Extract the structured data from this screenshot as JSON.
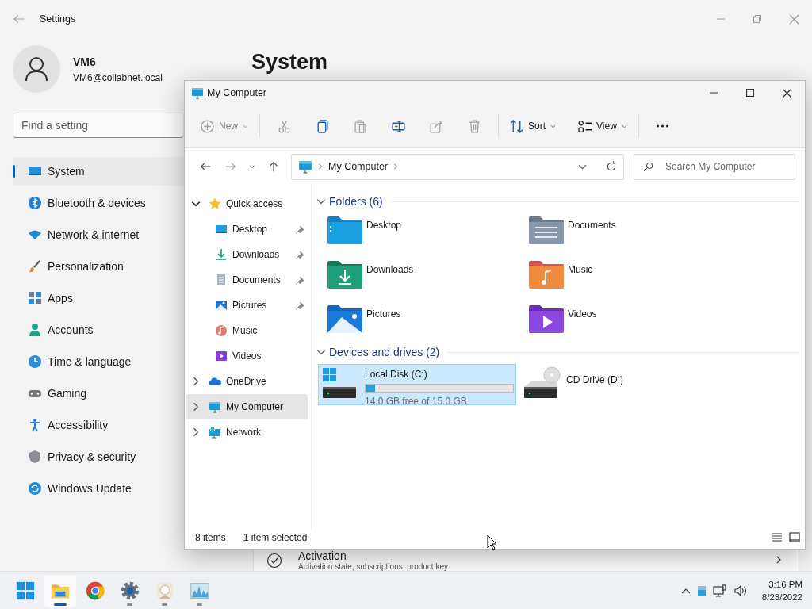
{
  "settings": {
    "title": "Settings",
    "user": {
      "name": "VM6",
      "email": "VM6@collabnet.local"
    },
    "search": {
      "placeholder": "Find a setting"
    },
    "nav": [
      {
        "label": "System",
        "selected": true
      },
      {
        "label": "Bluetooth & devices",
        "selected": false
      },
      {
        "label": "Network & internet",
        "selected": false
      },
      {
        "label": "Personalization",
        "selected": false
      },
      {
        "label": "Apps",
        "selected": false
      },
      {
        "label": "Accounts",
        "selected": false
      },
      {
        "label": "Time & language",
        "selected": false
      },
      {
        "label": "Gaming",
        "selected": false
      },
      {
        "label": "Accessibility",
        "selected": false
      },
      {
        "label": "Privacy & security",
        "selected": false
      },
      {
        "label": "Windows Update",
        "selected": false
      }
    ],
    "page_title": "System",
    "activation": {
      "title": "Activation",
      "subtitle": "Activation state, subscriptions, product key"
    }
  },
  "explorer": {
    "title": "My Computer",
    "toolbar": [
      {
        "kind": "new",
        "label": "New",
        "disabled": true
      },
      {
        "kind": "cut",
        "disabled": true
      },
      {
        "kind": "copy",
        "disabled": false
      },
      {
        "kind": "paste",
        "disabled": true
      },
      {
        "kind": "rename",
        "disabled": false
      },
      {
        "kind": "share",
        "disabled": true
      },
      {
        "kind": "delete",
        "disabled": true
      },
      {
        "kind": "sort",
        "label": "Sort",
        "disabled": false
      },
      {
        "kind": "view",
        "label": "View",
        "disabled": false
      },
      {
        "kind": "more",
        "disabled": false
      }
    ],
    "address": {
      "crumbs": [
        "My Computer"
      ]
    },
    "search": {
      "placeholder": "Search My Computer"
    },
    "tree": [
      {
        "label": "Quick access",
        "expanded": true,
        "selected": false,
        "children": [
          {
            "label": "Desktop",
            "pinned": true,
            "selected": false
          },
          {
            "label": "Downloads",
            "pinned": true,
            "selected": false
          },
          {
            "label": "Documents",
            "pinned": true,
            "selected": false
          },
          {
            "label": "Pictures",
            "pinned": true,
            "selected": false
          },
          {
            "label": "Music",
            "pinned": false,
            "selected": false
          },
          {
            "label": "Videos",
            "pinned": false,
            "selected": false
          }
        ]
      },
      {
        "label": "OneDrive",
        "expanded": false,
        "selected": false
      },
      {
        "label": "My Computer",
        "expanded": false,
        "selected": true
      },
      {
        "label": "Network",
        "expanded": false,
        "selected": false
      }
    ],
    "groups": [
      {
        "kind": "folders",
        "title": "Folders (6)",
        "expanded": true,
        "items": [
          {
            "label": "Desktop",
            "selected": false
          },
          {
            "label": "Documents",
            "selected": false
          },
          {
            "label": "Downloads",
            "selected": false
          },
          {
            "label": "Music",
            "selected": false
          },
          {
            "label": "Pictures",
            "selected": false
          },
          {
            "label": "Videos",
            "selected": false
          }
        ]
      },
      {
        "kind": "drives",
        "title": "Devices and drives (2)",
        "expanded": true,
        "items": [
          {
            "label": "Local Disk (C:)",
            "selected": true,
            "level": 0.067,
            "detail": "14.0 GB free of 15.0 GB"
          },
          {
            "label": "CD Drive (D:)",
            "selected": false
          }
        ]
      }
    ],
    "status": {
      "count": "8 items",
      "selection": "1 item selected"
    }
  },
  "taskbar": {
    "apps": [
      {
        "running": false,
        "active": false
      },
      {
        "running": true,
        "active": true
      },
      {
        "running": false,
        "active": false
      },
      {
        "running": true,
        "active": false
      },
      {
        "running": true,
        "active": false
      },
      {
        "running": true,
        "active": false
      }
    ],
    "clock": {
      "time": "3:16 PM",
      "date": "8/23/2022"
    }
  }
}
